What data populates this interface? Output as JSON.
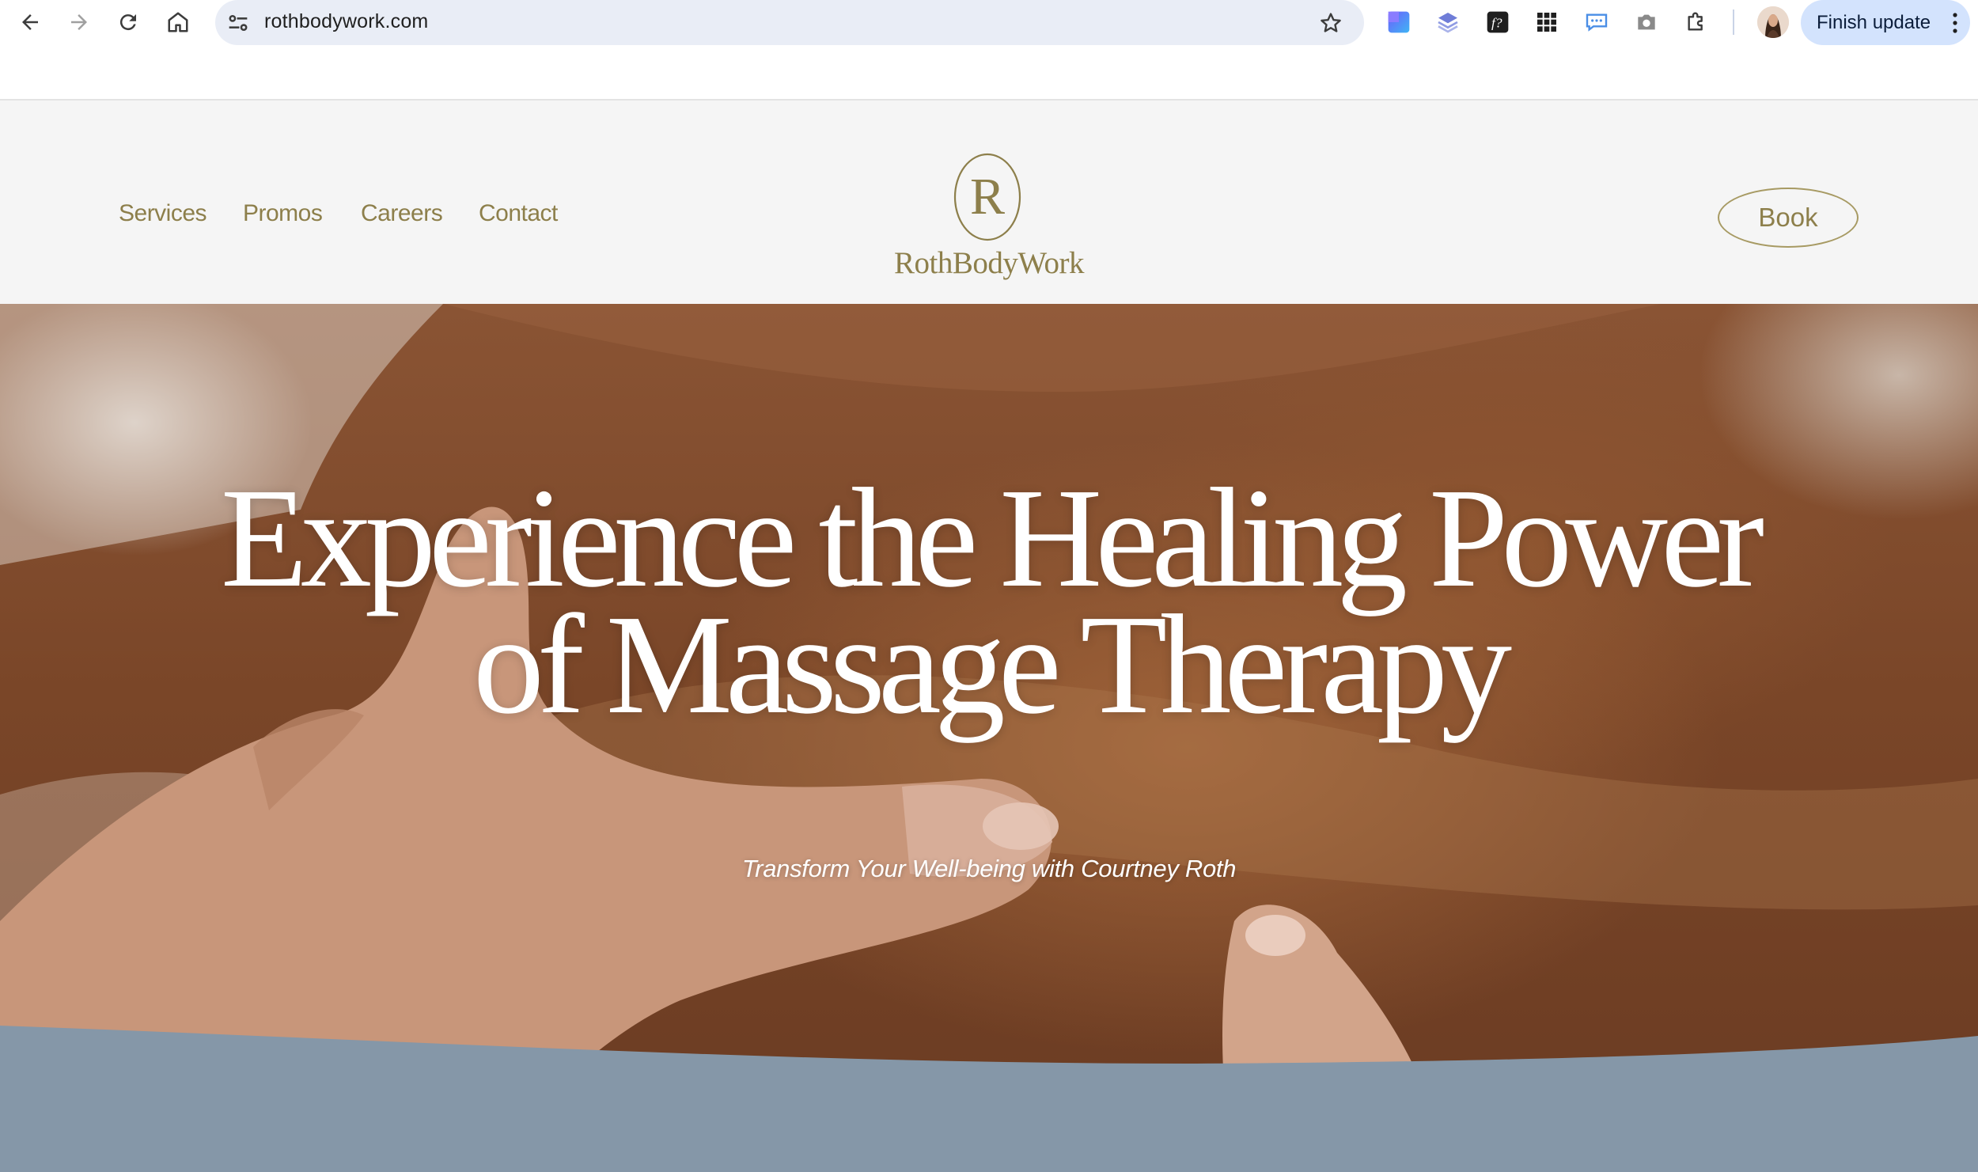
{
  "browser": {
    "url": "rothbodywork.com",
    "update_label": "Finish update"
  },
  "site": {
    "nav": [
      "Services",
      "Promos",
      "Careers",
      "Contact"
    ],
    "logo_text": "RothBodyWork",
    "logo_monogram": "R",
    "book_label": "Book"
  },
  "hero": {
    "headline_line1": "Experience the Healing Power",
    "headline_line2": "of Massage Therapy",
    "subheadline": "Transform Your Well-being with Courtney Roth"
  },
  "colors": {
    "brand_gold": "#8d7f4b",
    "header_bg": "#f5f5f5",
    "wave_blue": "#8597a8",
    "update_chip": "#d3e3fd"
  }
}
